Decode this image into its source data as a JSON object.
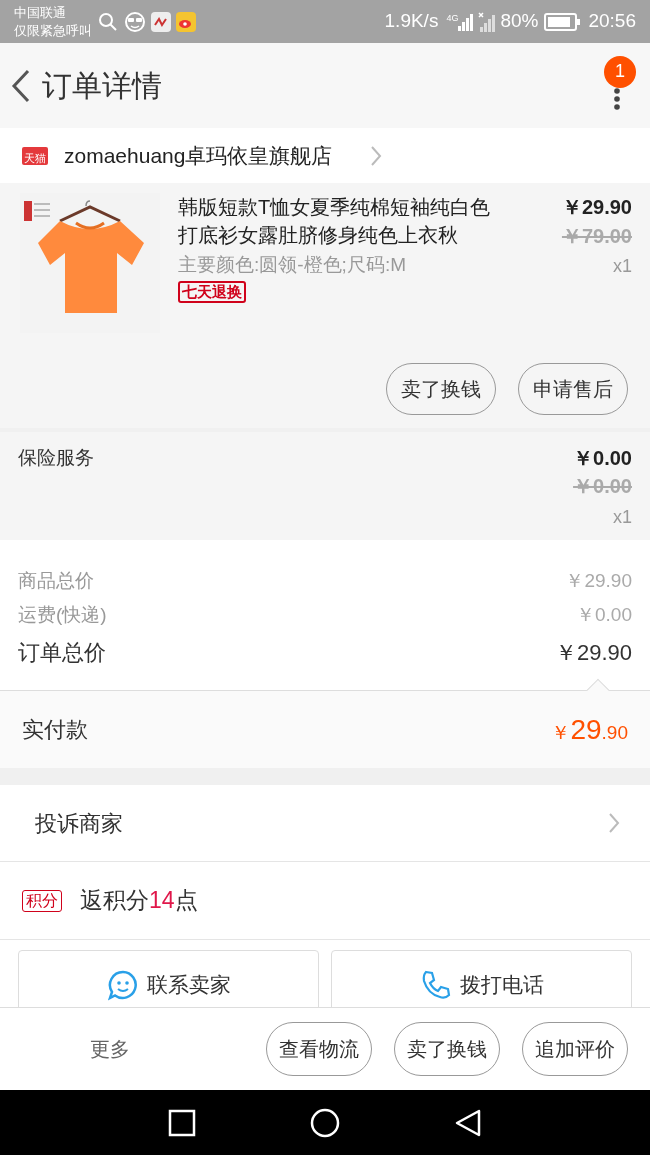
{
  "status_bar": {
    "carrier": "中国联通",
    "emergency": "仅限紧急呼叫",
    "speed": "1.9K/s",
    "network": "4G",
    "battery": "80%",
    "time": "20:56"
  },
  "header": {
    "title": "订单详情",
    "badge": "1"
  },
  "store": {
    "logo": "天猫",
    "name": "zomaehuang卓玛依皇旗舰店"
  },
  "product": {
    "title": "韩版短款T恤女夏季纯棉短袖纯白色打底衫女露肚脐修身纯色上衣秋",
    "spec": "主要颜色:圆领-橙色;尺码:M",
    "tag": "七天退换",
    "price": "￥29.90",
    "original_price": "￥79.00",
    "quantity": "x1",
    "buttons": [
      "卖了换钱",
      "申请售后"
    ]
  },
  "insurance": {
    "label": "保险服务",
    "price": "￥0.00",
    "original_price": "￥0.00",
    "quantity": "x1"
  },
  "summary": [
    {
      "label": "商品总价",
      "value": "￥29.90",
      "kind": "minor"
    },
    {
      "label": "运费(快递)",
      "value": "￥0.00",
      "kind": "minor"
    },
    {
      "label": "订单总价",
      "value": "￥29.90",
      "kind": "major"
    }
  ],
  "paid": {
    "label": "实付款",
    "currency": "￥",
    "integer": "29",
    "decimal": ".90"
  },
  "complaint": {
    "label": "投诉商家"
  },
  "points": {
    "tag": "积分",
    "before": "返积分",
    "value": "14",
    "after": "点"
  },
  "contact_buttons": [
    {
      "label": "联系卖家",
      "kind": "chat"
    },
    {
      "label": "拨打电话",
      "kind": "phone"
    }
  ],
  "bottom_bar": {
    "more": "更多",
    "buttons": [
      "查看物流",
      "卖了换钱",
      "追加评价"
    ]
  }
}
